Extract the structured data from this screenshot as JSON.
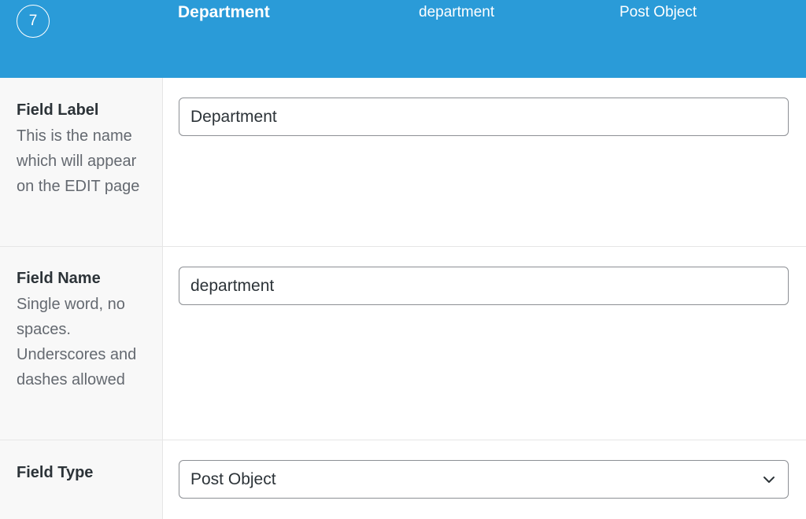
{
  "header": {
    "order": "7",
    "label": "Department",
    "name": "department",
    "type": "Post Object"
  },
  "rows": {
    "field_label": {
      "title": "Field Label",
      "description": "This is the name which will appear on the EDIT page",
      "value": "Department"
    },
    "field_name": {
      "title": "Field Name",
      "description": "Single word, no spaces. Underscores and dashes allowed",
      "value": "department"
    },
    "field_type": {
      "title": "Field Type",
      "value": "Post Object"
    }
  }
}
